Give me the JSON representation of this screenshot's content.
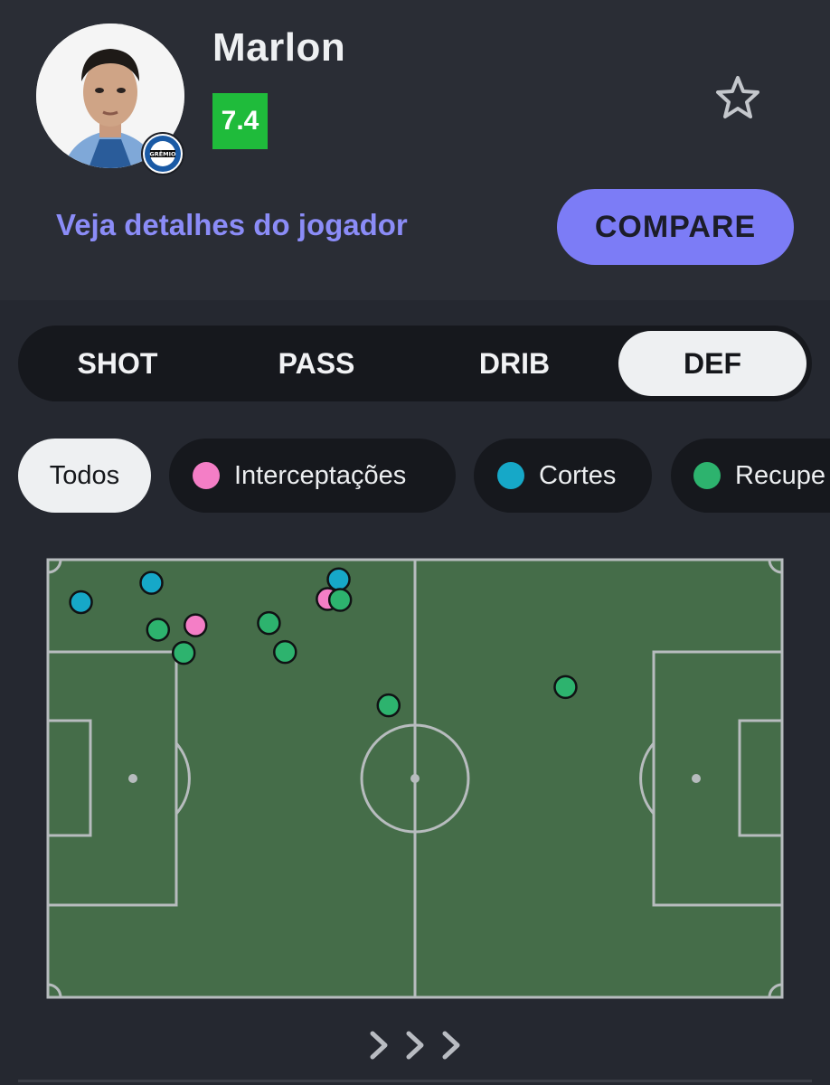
{
  "player": {
    "name": "Marlon",
    "rating": "7.4",
    "club_badge_text": "GRÊMIO"
  },
  "details_link": "Veja detalhes do jogador",
  "compare_label": "COMPARE",
  "tabs": [
    {
      "label": "SHOT",
      "active": false
    },
    {
      "label": "PASS",
      "active": false
    },
    {
      "label": "DRIB",
      "active": false
    },
    {
      "label": "DEF",
      "active": true
    }
  ],
  "filters": [
    {
      "label": "Todos",
      "active": true,
      "color": ""
    },
    {
      "label": "Interceptações",
      "active": false,
      "color": "#f47ec6"
    },
    {
      "label": "Cortes",
      "active": false,
      "color": "#16a8c8"
    },
    {
      "label": "Recupe",
      "active": false,
      "color": "#2db36e"
    }
  ],
  "colors": {
    "pitch": "#456d49",
    "pitch_lines": "#b7bcbe",
    "accent": "#7c7cf6",
    "rating_bg": "#1fbb3b"
  },
  "icons": {
    "favorite": "star-outline-icon",
    "more": "chevrons-right-icon"
  },
  "events": [
    {
      "type": "Cortes",
      "x": 4.5,
      "y": 9.7
    },
    {
      "type": "Cortes",
      "x": 14.1,
      "y": 5.3
    },
    {
      "type": "Cortes",
      "x": 39.6,
      "y": 4.5
    },
    {
      "type": "Interceptações",
      "x": 20.1,
      "y": 15.0
    },
    {
      "type": "Interceptações",
      "x": 38.1,
      "y": 9.0
    },
    {
      "type": "Recuperações",
      "x": 15.0,
      "y": 16.0
    },
    {
      "type": "Recuperações",
      "x": 18.5,
      "y": 21.3
    },
    {
      "type": "Recuperações",
      "x": 30.1,
      "y": 14.5
    },
    {
      "type": "Recuperações",
      "x": 32.3,
      "y": 21.1
    },
    {
      "type": "Recuperações",
      "x": 39.8,
      "y": 9.2
    },
    {
      "type": "Recuperações",
      "x": 46.4,
      "y": 33.3
    },
    {
      "type": "Recuperações",
      "x": 70.5,
      "y": 29.1
    }
  ]
}
